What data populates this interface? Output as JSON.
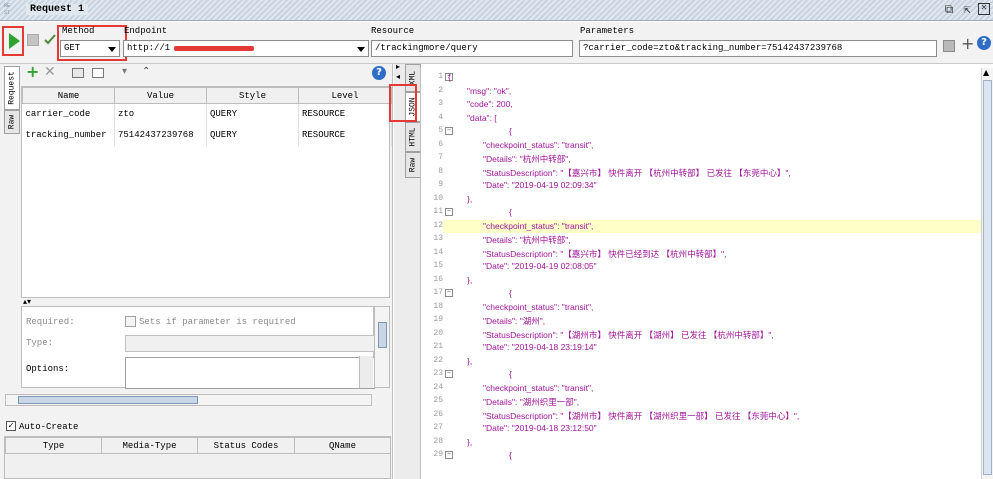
{
  "title": "Request 1",
  "toolbar": {
    "method_label": "Method",
    "method_value": "GET",
    "endpoint_label": "Endpoint",
    "endpoint_value": "http://1",
    "resource_label": "Resource",
    "resource_value": "/trackingmore/query",
    "parameters_label": "Parameters",
    "parameters_value": "?carrier_code=zto&tracking_number=75142437239768"
  },
  "left_tabs": [
    "Request",
    "Raw"
  ],
  "center_tabs": [
    "XML",
    "JSON",
    "HTML",
    "Raw"
  ],
  "params": {
    "columns": [
      "Name",
      "Value",
      "Style",
      "Level"
    ],
    "rows": [
      {
        "name": "carrier_code",
        "value": "zto",
        "style": "QUERY",
        "level": "RESOURCE"
      },
      {
        "name": "tracking_number",
        "value": "75142437239768",
        "style": "QUERY",
        "level": "RESOURCE"
      }
    ]
  },
  "props": {
    "required_label": "Required:",
    "required_checkbox_label": "Sets if parameter is required",
    "type_label": "Type:",
    "options_label": "Options:"
  },
  "auto_create_label": "Auto-Create",
  "representations": {
    "columns": [
      "Type",
      "Media-Type",
      "Status Codes",
      "QName"
    ]
  },
  "json_lines": [
    {
      "n": "1",
      "text": "{",
      "indent": 0,
      "fold": true
    },
    {
      "n": "2",
      "text": "\"msg\": \"ok\",",
      "indent": 1
    },
    {
      "n": "3",
      "text": "\"code\": 200,",
      "indent": 1
    },
    {
      "n": "4",
      "text": "\"data\":  [",
      "indent": 1
    },
    {
      "n": "5",
      "text": "{",
      "indent": 3,
      "fold": true
    },
    {
      "n": "6",
      "text": "\"checkpoint_status\": \"transit\",",
      "indent": 2
    },
    {
      "n": "7",
      "text": "\"Details\": \"杭州中转部\",",
      "indent": 2
    },
    {
      "n": "8",
      "text": "\"StatusDescription\": \"【嘉兴市】 快件离开 【杭州中转部】 已发往 【东莞中心】\",",
      "indent": 2
    },
    {
      "n": "9",
      "text": "\"Date\": \"2019-04-19 02:09:34\"",
      "indent": 2
    },
    {
      "n": "10",
      "text": "},",
      "indent": 1
    },
    {
      "n": "11",
      "text": "{",
      "indent": 3,
      "fold": true
    },
    {
      "n": "12",
      "text": "\"checkpoint_status\": \"transit\",",
      "indent": 2,
      "highlight": true
    },
    {
      "n": "13",
      "text": "\"Details\": \"杭州中转部\",",
      "indent": 2
    },
    {
      "n": "14",
      "text": "\"StatusDescription\": \"【嘉兴市】 快件已经到达 【杭州中转部】\",",
      "indent": 2
    },
    {
      "n": "15",
      "text": "\"Date\": \"2019-04-19 02:08:05\"",
      "indent": 2
    },
    {
      "n": "16",
      "text": "},",
      "indent": 1
    },
    {
      "n": "17",
      "text": "{",
      "indent": 3,
      "fold": true
    },
    {
      "n": "18",
      "text": "\"checkpoint_status\": \"transit\",",
      "indent": 2
    },
    {
      "n": "19",
      "text": "\"Details\": \"湖州\",",
      "indent": 2
    },
    {
      "n": "20",
      "text": "\"StatusDescription\": \"【湖州市】 快件离开 【湖州】 已发往 【杭州中转部】\",",
      "indent": 2
    },
    {
      "n": "21",
      "text": "\"Date\": \"2019-04-18 23:19:14\"",
      "indent": 2
    },
    {
      "n": "22",
      "text": "},",
      "indent": 1
    },
    {
      "n": "23",
      "text": "{",
      "indent": 3,
      "fold": true
    },
    {
      "n": "24",
      "text": "\"checkpoint_status\": \"transit\",",
      "indent": 2
    },
    {
      "n": "25",
      "text": "\"Details\": \"湖州织里一部\",",
      "indent": 2
    },
    {
      "n": "26",
      "text": "\"StatusDescription\": \"【湖州市】 快件离开 【湖州织里一部】 已发往 【东莞中心】\",",
      "indent": 2
    },
    {
      "n": "27",
      "text": "\"Date\": \"2019-04-18 23:12:50\"",
      "indent": 2
    },
    {
      "n": "28",
      "text": "},",
      "indent": 1
    },
    {
      "n": "29",
      "text": "{",
      "indent": 3,
      "fold": true
    }
  ],
  "colors": {
    "json_text": "#a0149a",
    "highlight": "#ffffc8",
    "annotation": "#e53935",
    "run_green": "#2fa32f"
  },
  "icons": [
    "rest-icon",
    "restore-icon",
    "float-icon",
    "close-icon",
    "run-icon",
    "stop-icon",
    "check-icon",
    "add-icon",
    "remove-icon",
    "help-icon",
    "collapse-icon",
    "expand-icon"
  ]
}
